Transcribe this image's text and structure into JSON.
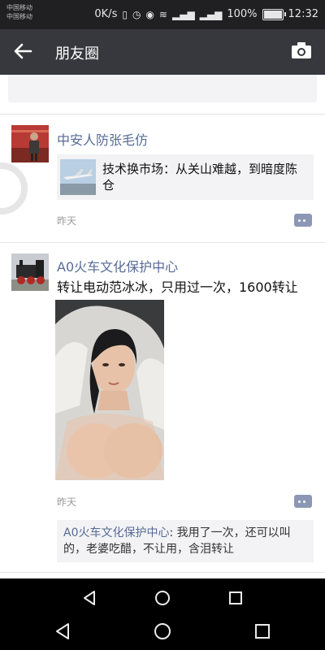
{
  "status_bar": {
    "carrier_line1": "中国移动",
    "carrier_line2": "中国移动",
    "speed": "0K/s",
    "battery": "100%",
    "battery_level": 1.0,
    "time": "12:32"
  },
  "title_bar": {
    "title": "朋友圈",
    "back_icon": "arrow-left-icon",
    "camera_icon": "camera-icon"
  },
  "posts": [
    {
      "name": "中安人防张毛仿",
      "share_title": "技术换市场：从关山难越，到暗度陈仓",
      "time": "昨天"
    },
    {
      "name": "A0火车文化保护中心",
      "text": "转让电动范冰冰，只用过一次，1600转让",
      "time": "昨天",
      "comment_author": "A0火车文化保护中心",
      "comment_text": ": 我用了一次，还可以叫的，老婆吃醋，不让用，含泪转让"
    }
  ],
  "colors": {
    "title_bar_bg": "#37383d",
    "name_link": "#576b95",
    "comment_bg": "#f3f3f5"
  }
}
